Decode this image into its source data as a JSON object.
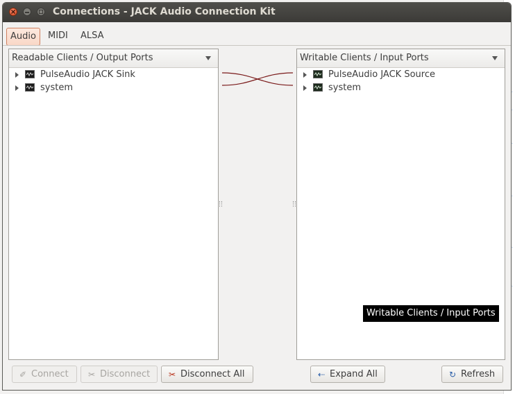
{
  "window": {
    "title": "Connections - JACK Audio Connection Kit"
  },
  "tabs": [
    {
      "label": "Audio",
      "active": true
    },
    {
      "label": "MIDI",
      "active": false
    },
    {
      "label": "ALSA",
      "active": false
    }
  ],
  "left_panel": {
    "header": "Readable Clients / Output Ports",
    "items": [
      {
        "label": "PulseAudio JACK Sink",
        "expanded": false
      },
      {
        "label": "system",
        "expanded": false
      }
    ]
  },
  "right_panel": {
    "header": "Writable Clients / Input Ports",
    "items": [
      {
        "label": "PulseAudio JACK Source",
        "expanded": false
      },
      {
        "label": "system",
        "expanded": false
      }
    ]
  },
  "connection_color": "#7a1a1a",
  "tooltip": "Writable Clients / Input Ports",
  "buttons": {
    "connect": {
      "label": "Connect",
      "enabled": false,
      "icon": "plug-icon"
    },
    "disconnect": {
      "label": "Disconnect",
      "enabled": false,
      "icon": "cut-icon"
    },
    "disconnect_all": {
      "label": "Disconnect All",
      "enabled": true,
      "icon": "cut-all-icon"
    },
    "expand_all": {
      "label": "Expand All",
      "enabled": true,
      "icon": "expand-icon"
    },
    "refresh": {
      "label": "Refresh",
      "enabled": true,
      "icon": "refresh-icon"
    }
  },
  "accent_color": "#d08060"
}
